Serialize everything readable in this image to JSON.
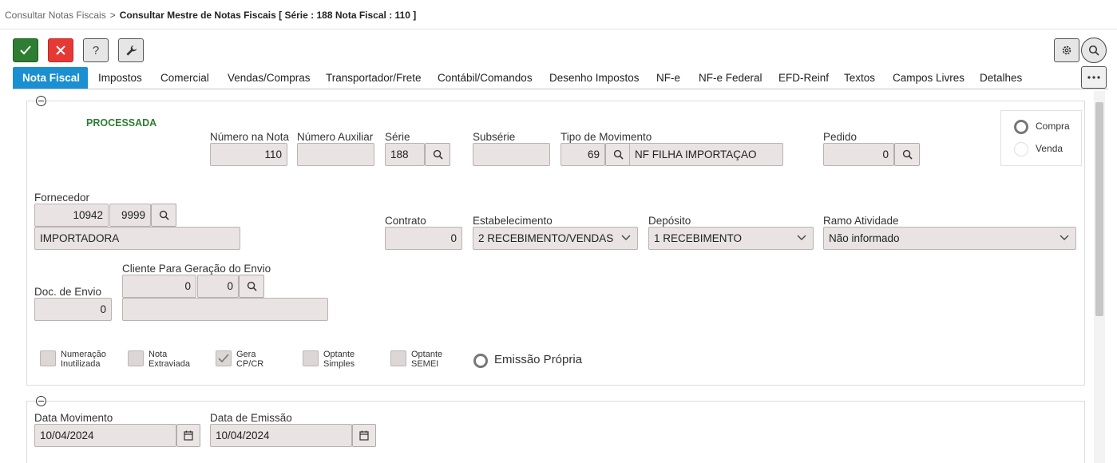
{
  "breadcrumb": {
    "parent": "Consultar Notas Fiscais",
    "separator": ">",
    "current": "Consultar Mestre de Notas Fiscais [ Série : 188 Nota Fiscal : 110 ]"
  },
  "toolbar": {
    "confirm_icon": "check-icon",
    "cancel_icon": "close-icon",
    "help_label": "?",
    "tools_icon": "wrench-icon",
    "settings_icon": "gear-icon",
    "search_icon": "search-icon"
  },
  "tabs": [
    "Nota Fiscal",
    "Impostos",
    "Comercial",
    "Vendas/Compras",
    "Transportador/Frete",
    "Contábil/Comandos",
    "Desenho Impostos",
    "NF-e",
    "NF-e Federal",
    "EFD-Reinf",
    "Textos",
    "Campos Livres",
    "Detalhes"
  ],
  "active_tab": "Nota Fiscal",
  "accent_color": "#1a8fd1",
  "status": {
    "text": "PROCESSADA",
    "color": "#2e7d32"
  },
  "fields": {
    "numero_nota": {
      "label": "Número na Nota",
      "value": "110"
    },
    "numero_auxiliar": {
      "label": "Número Auxiliar",
      "value": ""
    },
    "serie": {
      "label": "Série",
      "value": "188"
    },
    "subserie": {
      "label": "Subsérie",
      "value": ""
    },
    "tipo_movimento": {
      "label": "Tipo de Movimento",
      "code": "69",
      "description": "NF FILHA IMPORTAÇAO"
    },
    "pedido": {
      "label": "Pedido",
      "value": "0"
    },
    "fornecedor": {
      "label": "Fornecedor",
      "code": "10942",
      "sub_code": "9999",
      "name": "IMPORTADORA"
    },
    "contrato": {
      "label": "Contrato",
      "value": "0"
    },
    "estabelecimento": {
      "label": "Estabelecimento",
      "value": "2 RECEBIMENTO/VENDAS"
    },
    "deposito": {
      "label": "Depósito",
      "value": "1 RECEBIMENTO"
    },
    "ramo_atividade": {
      "label": "Ramo Atividade",
      "value": "Não informado"
    },
    "doc_envio": {
      "label": "Doc. de Envio",
      "value": "0"
    },
    "cliente_envio": {
      "label": "Cliente Para Geração do Envio",
      "code": "0",
      "sub_code": "0",
      "name": ""
    },
    "data_movimento": {
      "label": "Data Movimento",
      "value": "10/04/2024"
    },
    "data_emissao": {
      "label": "Data de Emissão",
      "value": "10/04/2024"
    }
  },
  "radio_group": {
    "options": [
      "Compra",
      "Venda"
    ],
    "selected": "Compra"
  },
  "checkboxes": [
    {
      "line1": "Numeração",
      "line2": "Inutilizada",
      "checked": false
    },
    {
      "line1": "Nota",
      "line2": "Extraviada",
      "checked": false
    },
    {
      "line1": "Gera",
      "line2": "CP/CR",
      "checked": true
    },
    {
      "line1": "Optante",
      "line2": "Simples",
      "checked": false
    },
    {
      "line1": "Optante",
      "line2": "SEMEI",
      "checked": false
    }
  ],
  "emissao_propria": {
    "label": "Emissão Própria",
    "selected": false
  }
}
